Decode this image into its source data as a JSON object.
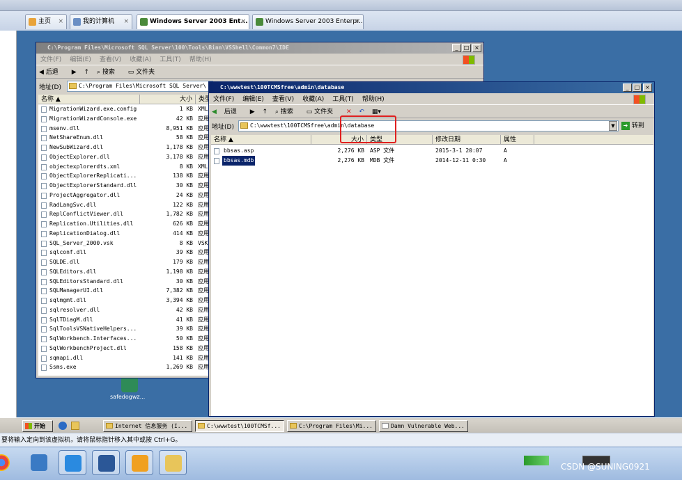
{
  "host": {
    "tabs": [
      {
        "label": "主页"
      },
      {
        "label": "我的计算机"
      },
      {
        "label": "Windows Server 2003 Ent..."
      },
      {
        "label": "Windows Server 2003 Enterpr..."
      }
    ]
  },
  "desktop": {
    "icon_label": "safedogwz..."
  },
  "win1": {
    "title": "C:\\Program Files\\Microsoft SQL Server\\100\\Tools\\Binn\\VSShell\\Common7\\IDE",
    "menu": [
      "文件(F)",
      "编辑(E)",
      "查看(V)",
      "收藏(A)",
      "工具(T)",
      "帮助(H)"
    ],
    "toolbar": {
      "back": "后退",
      "search": "搜索",
      "folders": "文件夹"
    },
    "address_label": "地址(D)",
    "address": "C:\\Program Files\\Microsoft SQL Server\\",
    "columns": {
      "name": "名称 ▲",
      "size": "大小",
      "type": "类型"
    },
    "files": [
      {
        "name": "MigrationWizard.exe.config",
        "size": "1 KB",
        "type": "XML"
      },
      {
        "name": "MigrationWizardConsole.exe",
        "size": "42 KB",
        "type": "应用"
      },
      {
        "name": "msenv.dll",
        "size": "8,951 KB",
        "type": "应用"
      },
      {
        "name": "NetShareEnum.dll",
        "size": "58 KB",
        "type": "应用"
      },
      {
        "name": "NewSubWizard.dll",
        "size": "1,178 KB",
        "type": "应用"
      },
      {
        "name": "ObjectExplorer.dll",
        "size": "3,178 KB",
        "type": "应用"
      },
      {
        "name": "objectexplorerdts.xml",
        "size": "8 KB",
        "type": "XML"
      },
      {
        "name": "ObjectExplorerReplicati...",
        "size": "138 KB",
        "type": "应用"
      },
      {
        "name": "ObjectExplorerStandard.dll",
        "size": "30 KB",
        "type": "应用"
      },
      {
        "name": "ProjectAggregator.dll",
        "size": "24 KB",
        "type": "应用"
      },
      {
        "name": "RadLangSvc.dll",
        "size": "122 KB",
        "type": "应用"
      },
      {
        "name": "ReplConflictViewer.dll",
        "size": "1,782 KB",
        "type": "应用"
      },
      {
        "name": "Replication.Utilities.dll",
        "size": "626 KB",
        "type": "应用"
      },
      {
        "name": "ReplicationDialog.dll",
        "size": "414 KB",
        "type": "应用"
      },
      {
        "name": "SQL_Server_2000.vsk",
        "size": "8 KB",
        "type": "VSK"
      },
      {
        "name": "sqlconf.dll",
        "size": "39 KB",
        "type": "应用"
      },
      {
        "name": "SQLDE.dll",
        "size": "179 KB",
        "type": "应用"
      },
      {
        "name": "SQLEditors.dll",
        "size": "1,198 KB",
        "type": "应用"
      },
      {
        "name": "SQLEditorsStandard.dll",
        "size": "30 KB",
        "type": "应用"
      },
      {
        "name": "SQLManagerUI.dll",
        "size": "7,382 KB",
        "type": "应用"
      },
      {
        "name": "sqlmgmt.dll",
        "size": "3,394 KB",
        "type": "应用"
      },
      {
        "name": "sqlresolver.dll",
        "size": "42 KB",
        "type": "应用"
      },
      {
        "name": "SqlTDiagM.dll",
        "size": "41 KB",
        "type": "应用"
      },
      {
        "name": "SqlToolsVSNativeHelpers...",
        "size": "39 KB",
        "type": "应用"
      },
      {
        "name": "SqlWorkbench.Interfaces...",
        "size": "50 KB",
        "type": "应用"
      },
      {
        "name": "SqlWorkbenchProject.dll",
        "size": "158 KB",
        "type": "应用"
      },
      {
        "name": "sqmapi.dll",
        "size": "141 KB",
        "type": "应用"
      },
      {
        "name": "Ssms.exe",
        "size": "1,269 KB",
        "type": "应用"
      }
    ]
  },
  "win2": {
    "title": "C:\\wwwtest\\100TCMSfree\\admin\\database",
    "menu": [
      "文件(F)",
      "编辑(E)",
      "查看(V)",
      "收藏(A)",
      "工具(T)",
      "帮助(H)"
    ],
    "toolbar": {
      "back": "后退",
      "search": "搜索",
      "folders": "文件夹"
    },
    "address_label": "地址(D)",
    "address": "C:\\wwwtest\\100TCMSfree\\admin\\database",
    "go_label": "转到",
    "columns": {
      "name": "名称 ▲",
      "size": "大小",
      "type": "类型",
      "modified": "修改日期",
      "attr": "属性"
    },
    "files": [
      {
        "name": "bbsas.asp",
        "size": "2,276 KB",
        "type": "ASP 文件",
        "modified": "2015-3-1 20:07",
        "attr": "A"
      },
      {
        "name": "bbsas.mdb",
        "size": "2,276 KB",
        "type": "MDB 文件",
        "modified": "2014-12-11 0:30",
        "attr": "A"
      }
    ]
  },
  "taskbar": {
    "start": "开始",
    "items": [
      {
        "label": "Internet 信息服务 (I..."
      },
      {
        "label": "C:\\wwwtest\\100TCMSf..."
      },
      {
        "label": "C:\\Program Files\\Mi..."
      },
      {
        "label": "Damn Vulnerable Web..."
      }
    ]
  },
  "hint": "要将输入定向到该虚拟机，请将鼠标指针移入其中或按 Ctrl+G。",
  "watermark": "CSDN @SUNING0921"
}
